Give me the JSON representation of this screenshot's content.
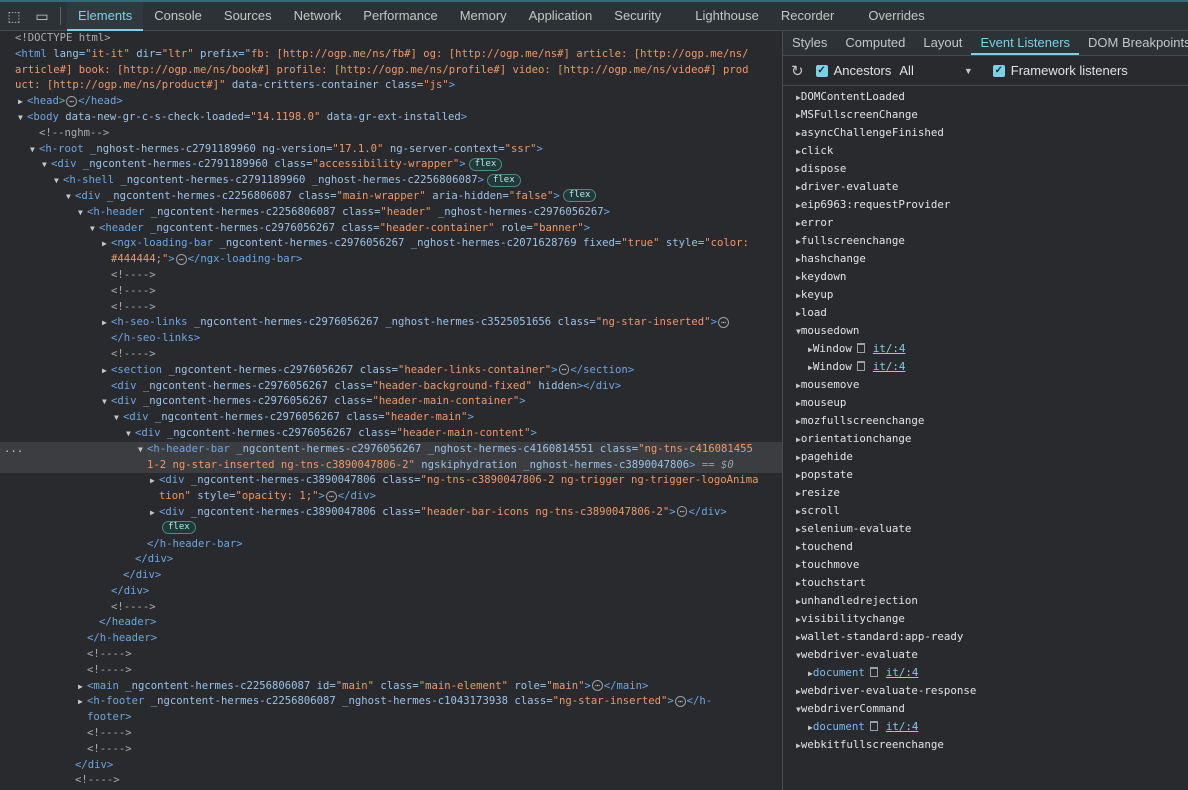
{
  "toolbar": {
    "icons": [
      "inspect-element-icon",
      "device-toolbar-icon"
    ],
    "tabs": [
      {
        "label": "Elements",
        "active": true
      },
      {
        "label": "Console"
      },
      {
        "label": "Sources"
      },
      {
        "label": "Network"
      },
      {
        "label": "Performance"
      },
      {
        "label": "Memory"
      },
      {
        "label": "Application"
      },
      {
        "label": "Security"
      },
      {
        "label": "Lighthouse"
      },
      {
        "label": "Recorder"
      },
      {
        "label": "Overrides"
      }
    ]
  },
  "dom": {
    "selected_marker": "...",
    "lines": [
      {
        "l": 0,
        "s": [
          [
            "c",
            "<!DOCTYPE html>"
          ]
        ]
      },
      {
        "l": 0,
        "s": [
          [
            "t",
            "<html"
          ],
          [
            "n",
            " lang="
          ],
          [
            "v",
            "\"it-it\""
          ],
          [
            "n",
            " dir="
          ],
          [
            "v",
            "\"ltr\""
          ],
          [
            "n",
            " prefix="
          ],
          [
            "v",
            "\"fb: [http://ogp.me/ns/fb#] og: [http://ogp.me/ns#] article: [http://ogp.me/ns/"
          ]
        ]
      },
      {
        "l": 0,
        "s": [
          [
            "v",
            "article#] book: [http://ogp.me/ns/book#] profile: [http://ogp.me/ns/profile#] video: [http://ogp.me/ns/video#] prod"
          ]
        ]
      },
      {
        "l": 0,
        "s": [
          [
            "v",
            "uct: [http://ogp.me/ns/product#]\""
          ],
          [
            "n",
            " data-critters-container class="
          ],
          [
            "v",
            "\"js\""
          ],
          [
            "t",
            ">"
          ]
        ]
      },
      {
        "l": 1,
        "a": "closed",
        "s": [
          [
            "t",
            "<head>"
          ],
          [
            "e",
            "⋯"
          ],
          [
            "t",
            "</head>"
          ]
        ]
      },
      {
        "l": 1,
        "a": "open",
        "s": [
          [
            "t",
            "<body"
          ],
          [
            "n",
            " data-new-gr-c-s-check-loaded="
          ],
          [
            "v",
            "\"14.1198.0\""
          ],
          [
            "n",
            " data-gr-ext-installed"
          ],
          [
            "t",
            ">"
          ]
        ]
      },
      {
        "l": 2,
        "s": [
          [
            "c",
            "<!--nghm-->"
          ]
        ]
      },
      {
        "l": 2,
        "a": "open",
        "s": [
          [
            "t",
            "<h-root"
          ],
          [
            "n",
            " _nghost-hermes-c2791189960 ng-version="
          ],
          [
            "v",
            "\"17.1.0\""
          ],
          [
            "n",
            " ng-server-context="
          ],
          [
            "v",
            "\"ssr\""
          ],
          [
            "t",
            ">"
          ]
        ]
      },
      {
        "l": 3,
        "a": "open",
        "s": [
          [
            "t",
            "<div"
          ],
          [
            "n",
            " _ngcontent-hermes-c2791189960 class="
          ],
          [
            "v",
            "\"accessibility-wrapper\""
          ],
          [
            "t",
            ">"
          ],
          [
            "b",
            "flex"
          ]
        ]
      },
      {
        "l": 4,
        "a": "open",
        "s": [
          [
            "t",
            "<h-shell"
          ],
          [
            "n",
            " _ngcontent-hermes-c2791189960 _nghost-hermes-c2256806087"
          ],
          [
            "t",
            ">"
          ],
          [
            "b",
            "flex"
          ]
        ]
      },
      {
        "l": 5,
        "a": "open",
        "s": [
          [
            "t",
            "<div"
          ],
          [
            "n",
            " _ngcontent-hermes-c2256806087 class="
          ],
          [
            "v",
            "\"main-wrapper\""
          ],
          [
            "n",
            " aria-hidden="
          ],
          [
            "v",
            "\"false\""
          ],
          [
            "t",
            ">"
          ],
          [
            "b",
            "flex"
          ]
        ]
      },
      {
        "l": 6,
        "a": "open",
        "s": [
          [
            "t",
            "<h-header"
          ],
          [
            "n",
            " _ngcontent-hermes-c2256806087 class="
          ],
          [
            "v",
            "\"header\""
          ],
          [
            "n",
            " _nghost-hermes-c2976056267"
          ],
          [
            "t",
            ">"
          ]
        ]
      },
      {
        "l": 7,
        "a": "open",
        "s": [
          [
            "t",
            "<header"
          ],
          [
            "n",
            " _ngcontent-hermes-c2976056267 class="
          ],
          [
            "v",
            "\"header-container\""
          ],
          [
            "n",
            " role="
          ],
          [
            "v",
            "\"banner\""
          ],
          [
            "t",
            ">"
          ]
        ]
      },
      {
        "l": 8,
        "a": "closed",
        "s": [
          [
            "t",
            "<ngx-loading-bar"
          ],
          [
            "n",
            " _ngcontent-hermes-c2976056267 _nghost-hermes-c2071628769 fixed="
          ],
          [
            "v",
            "\"true\""
          ],
          [
            "n",
            " style="
          ],
          [
            "v",
            "\"color:"
          ]
        ]
      },
      {
        "l": 8,
        "s": [
          [
            "v",
            "#444444;\""
          ],
          [
            "t",
            ">"
          ],
          [
            "e",
            "⋯"
          ],
          [
            "t",
            "</ngx-loading-bar>"
          ]
        ]
      },
      {
        "l": 8,
        "s": [
          [
            "c",
            "<!---->"
          ]
        ]
      },
      {
        "l": 8,
        "s": [
          [
            "c",
            "<!---->"
          ]
        ]
      },
      {
        "l": 8,
        "s": [
          [
            "c",
            "<!---->"
          ]
        ]
      },
      {
        "l": 8,
        "a": "closed",
        "s": [
          [
            "t",
            "<h-seo-links"
          ],
          [
            "n",
            " _ngcontent-hermes-c2976056267 _nghost-hermes-c3525051656 class="
          ],
          [
            "v",
            "\"ng-star-inserted\""
          ],
          [
            "t",
            ">"
          ],
          [
            "e",
            "⋯"
          ]
        ]
      },
      {
        "l": 8,
        "s": [
          [
            "t",
            "</h-seo-links>"
          ]
        ]
      },
      {
        "l": 8,
        "s": [
          [
            "c",
            "<!---->"
          ]
        ]
      },
      {
        "l": 8,
        "a": "closed",
        "s": [
          [
            "t",
            "<section"
          ],
          [
            "n",
            " _ngcontent-hermes-c2976056267 class="
          ],
          [
            "v",
            "\"header-links-container\""
          ],
          [
            "t",
            ">"
          ],
          [
            "e",
            "⋯"
          ],
          [
            "t",
            "</section>"
          ]
        ]
      },
      {
        "l": 8,
        "s": [
          [
            "t",
            "<div"
          ],
          [
            "n",
            " _ngcontent-hermes-c2976056267 class="
          ],
          [
            "v",
            "\"header-background-fixed\""
          ],
          [
            "n",
            " hidden"
          ],
          [
            "t",
            ">"
          ],
          [
            "t",
            "</div>"
          ]
        ]
      },
      {
        "l": 8,
        "a": "open",
        "s": [
          [
            "t",
            "<div"
          ],
          [
            "n",
            " _ngcontent-hermes-c2976056267 class="
          ],
          [
            "v",
            "\"header-main-container\""
          ],
          [
            "t",
            ">"
          ]
        ]
      },
      {
        "l": 9,
        "a": "open",
        "s": [
          [
            "t",
            "<div"
          ],
          [
            "n",
            " _ngcontent-hermes-c2976056267 class="
          ],
          [
            "v",
            "\"header-main\""
          ],
          [
            "t",
            ">"
          ]
        ]
      },
      {
        "l": 10,
        "a": "open",
        "s": [
          [
            "t",
            "<div"
          ],
          [
            "n",
            " _ngcontent-hermes-c2976056267 class="
          ],
          [
            "v",
            "\"header-main-content\""
          ],
          [
            "t",
            ">"
          ]
        ]
      },
      {
        "l": 11,
        "a": "open",
        "sel": true,
        "s": [
          [
            "t",
            "<h-header-bar"
          ],
          [
            "n",
            " _ngcontent-hermes-c2976056267 _nghost-hermes-c4160814551 class="
          ],
          [
            "v",
            "\"ng-tns-c416081455"
          ]
        ]
      },
      {
        "l": 11,
        "sel": true,
        "s": [
          [
            "v",
            "1-2 ng-star-inserted ng-tns-c3890047806-2\""
          ],
          [
            "n",
            " ngskiphydration _nghost-hermes-c3890047806"
          ],
          [
            "t",
            ">"
          ],
          [
            "d",
            " == $0"
          ]
        ]
      },
      {
        "l": 12,
        "a": "closed",
        "s": [
          [
            "t",
            "<div"
          ],
          [
            "n",
            " _ngcontent-hermes-c3890047806 class="
          ],
          [
            "v",
            "\"ng-tns-c3890047806-2 ng-trigger ng-trigger-logoAnima"
          ]
        ]
      },
      {
        "l": 12,
        "s": [
          [
            "v",
            "tion\""
          ],
          [
            "n",
            " style="
          ],
          [
            "v",
            "\"opacity: 1;\""
          ],
          [
            "t",
            ">"
          ],
          [
            "e",
            "⋯"
          ],
          [
            "t",
            "</div>"
          ]
        ]
      },
      {
        "l": 12,
        "a": "closed",
        "s": [
          [
            "t",
            "<div"
          ],
          [
            "n",
            " _ngcontent-hermes-c3890047806 class="
          ],
          [
            "v",
            "\"header-bar-icons ng-tns-c3890047806-2\""
          ],
          [
            "t",
            ">"
          ],
          [
            "e",
            "⋯"
          ],
          [
            "t",
            "</div>"
          ]
        ]
      },
      {
        "l": 12,
        "s": [
          [
            "b",
            "flex"
          ]
        ]
      },
      {
        "l": 11,
        "s": [
          [
            "t",
            "</h-header-bar>"
          ]
        ]
      },
      {
        "l": 10,
        "s": [
          [
            "t",
            "</div>"
          ]
        ]
      },
      {
        "l": 9,
        "s": [
          [
            "t",
            "</div>"
          ]
        ]
      },
      {
        "l": 8,
        "s": [
          [
            "t",
            "</div>"
          ]
        ]
      },
      {
        "l": 8,
        "s": [
          [
            "c",
            "<!---->"
          ]
        ]
      },
      {
        "l": 7,
        "s": [
          [
            "t",
            "</header>"
          ]
        ]
      },
      {
        "l": 6,
        "s": [
          [
            "t",
            "</h-header>"
          ]
        ]
      },
      {
        "l": 6,
        "s": [
          [
            "c",
            "<!---->"
          ]
        ]
      },
      {
        "l": 6,
        "s": [
          [
            "c",
            "<!---->"
          ]
        ]
      },
      {
        "l": 6,
        "a": "closed",
        "s": [
          [
            "t",
            "<main"
          ],
          [
            "n",
            " _ngcontent-hermes-c2256806087 id="
          ],
          [
            "v",
            "\"main\""
          ],
          [
            "n",
            " class="
          ],
          [
            "v",
            "\"main-element\""
          ],
          [
            "n",
            " role="
          ],
          [
            "v",
            "\"main\""
          ],
          [
            "t",
            ">"
          ],
          [
            "e",
            "⋯"
          ],
          [
            "t",
            "</main>"
          ]
        ]
      },
      {
        "l": 6,
        "a": "closed",
        "s": [
          [
            "t",
            "<h-footer"
          ],
          [
            "n",
            " _ngcontent-hermes-c2256806087 _nghost-hermes-c1043173938 class="
          ],
          [
            "v",
            "\"ng-star-inserted\""
          ],
          [
            "t",
            ">"
          ],
          [
            "e",
            "⋯"
          ],
          [
            "t",
            "</h-"
          ]
        ]
      },
      {
        "l": 6,
        "s": [
          [
            "t",
            "footer>"
          ]
        ]
      },
      {
        "l": 6,
        "s": [
          [
            "c",
            "<!---->"
          ]
        ]
      },
      {
        "l": 6,
        "s": [
          [
            "c",
            "<!---->"
          ]
        ]
      },
      {
        "l": 5,
        "s": [
          [
            "t",
            "</div>"
          ]
        ]
      },
      {
        "l": 5,
        "s": [
          [
            "c",
            "<!---->"
          ]
        ]
      }
    ]
  },
  "sidebar": {
    "tabs": [
      {
        "label": "Styles"
      },
      {
        "label": "Computed"
      },
      {
        "label": "Layout"
      },
      {
        "label": "Event Listeners",
        "active": true
      },
      {
        "label": "DOM Breakpoints"
      }
    ],
    "toolbar": {
      "ancestors_label": "Ancestors",
      "ancestors_checked": true,
      "filter_value": "All",
      "framework_label": "Framework listeners",
      "framework_checked": true
    },
    "events": [
      {
        "name": "DOMContentLoaded"
      },
      {
        "name": "MSFullscreenChange"
      },
      {
        "name": "asyncChallengeFinished"
      },
      {
        "name": "click"
      },
      {
        "name": "dispose"
      },
      {
        "name": "driver-evaluate"
      },
      {
        "name": "eip6963:requestProvider"
      },
      {
        "name": "error"
      },
      {
        "name": "fullscreenchange"
      },
      {
        "name": "hashchange"
      },
      {
        "name": "keydown"
      },
      {
        "name": "keyup"
      },
      {
        "name": "load"
      },
      {
        "name": "mousedown",
        "open": true,
        "children": [
          {
            "node": "Window",
            "source": "it/:4"
          },
          {
            "node": "Window",
            "source": "it/:4"
          }
        ]
      },
      {
        "name": "mousemove"
      },
      {
        "name": "mouseup"
      },
      {
        "name": "mozfullscreenchange"
      },
      {
        "name": "orientationchange"
      },
      {
        "name": "pagehide"
      },
      {
        "name": "popstate"
      },
      {
        "name": "resize"
      },
      {
        "name": "scroll"
      },
      {
        "name": "selenium-evaluate"
      },
      {
        "name": "touchend"
      },
      {
        "name": "touchmove"
      },
      {
        "name": "touchstart"
      },
      {
        "name": "unhandledrejection"
      },
      {
        "name": "visibilitychange"
      },
      {
        "name": "wallet-standard:app-ready"
      },
      {
        "name": "webdriver-evaluate",
        "open": true,
        "children": [
          {
            "node": "document",
            "source": "it/:4",
            "blue": true
          }
        ]
      },
      {
        "name": "webdriver-evaluate-response"
      },
      {
        "name": "webdriverCommand",
        "open": true,
        "children": [
          {
            "node": "document",
            "source": "it/:4",
            "blue": true
          }
        ]
      },
      {
        "name": "webkitfullscreenchange"
      }
    ]
  },
  "colors": {
    "accent": "#7cd1e4",
    "tag": "#6ca6e3",
    "attr_name": "#9cc2e8",
    "attr_value": "#f29766",
    "background": "#282a2d"
  }
}
